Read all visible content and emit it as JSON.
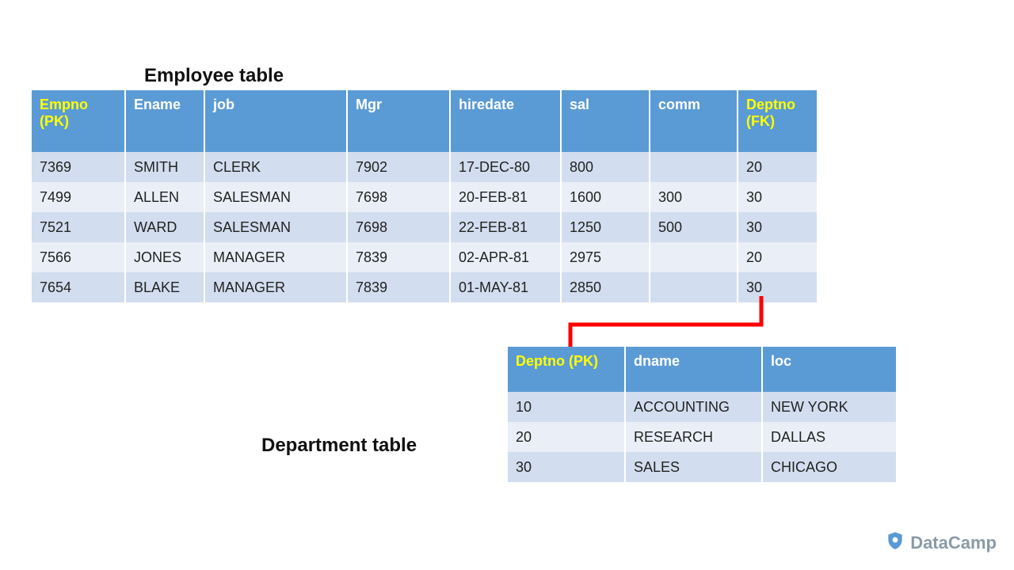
{
  "employee": {
    "title": "Employee table",
    "headers": [
      "Empno (PK)",
      "Ename",
      "job",
      "Mgr",
      "hiredate",
      "sal",
      "comm",
      "Deptno (FK)"
    ],
    "key_cols": [
      0,
      7
    ],
    "rows": [
      [
        "7369",
        "SMITH",
        "CLERK",
        "7902",
        "17-DEC-80",
        "800",
        "",
        "20"
      ],
      [
        "7499",
        "ALLEN",
        "SALESMAN",
        "7698",
        "20-FEB-81",
        "1600",
        "300",
        "30"
      ],
      [
        "7521",
        "WARD",
        "SALESMAN",
        "7698",
        "22-FEB-81",
        "1250",
        "500",
        "30"
      ],
      [
        "7566",
        "JONES",
        "MANAGER",
        "7839",
        "02-APR-81",
        "2975",
        "",
        "20"
      ],
      [
        "7654",
        "BLAKE",
        "MANAGER",
        "7839",
        "01-MAY-81",
        "2850",
        "",
        "30"
      ]
    ]
  },
  "department": {
    "title": "Department table",
    "headers": [
      "Deptno (PK)",
      "dname",
      "loc"
    ],
    "key_cols": [
      0
    ],
    "rows": [
      [
        "10",
        "ACCOUNTING",
        "NEW YORK"
      ],
      [
        "20",
        "RESEARCH",
        "DALLAS"
      ],
      [
        "30",
        "SALES",
        "CHICAGO"
      ]
    ]
  },
  "brand": "DataCamp",
  "colors": {
    "header_bg": "#5b9bd5",
    "row_odd": "#d2deef",
    "row_even": "#eaeff7",
    "key_text": "#ffff00",
    "connector": "#ff0000"
  }
}
